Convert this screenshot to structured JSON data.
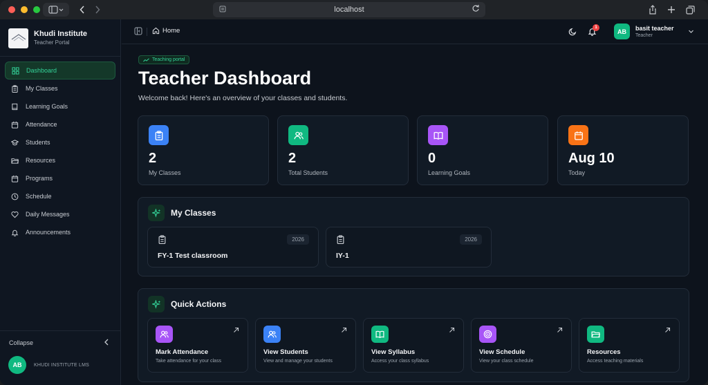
{
  "browser": {
    "url": "localhost",
    "traffic_lights": [
      "#ff5f57",
      "#febc2e",
      "#28c840"
    ]
  },
  "sidebar": {
    "brand_title": "Khudi Institute",
    "brand_subtitle": "Teacher Portal",
    "items": [
      {
        "label": "Dashboard",
        "icon": "dashboard-icon",
        "active": true
      },
      {
        "label": "My Classes",
        "icon": "clipboard-icon"
      },
      {
        "label": "Learning Goals",
        "icon": "book-icon"
      },
      {
        "label": "Attendance",
        "icon": "calendar-icon"
      },
      {
        "label": "Students",
        "icon": "graduation-cap-icon"
      },
      {
        "label": "Resources",
        "icon": "folder-icon"
      },
      {
        "label": "Programs",
        "icon": "calendar-icon"
      },
      {
        "label": "Schedule",
        "icon": "clock-icon"
      },
      {
        "label": "Daily Messages",
        "icon": "heart-icon"
      },
      {
        "label": "Announcements",
        "icon": "bell-icon"
      }
    ],
    "collapse_label": "Collapse",
    "footer_initials": "AB",
    "footer_text": "KHUDI INSTITUTE LMS"
  },
  "topbar": {
    "breadcrumb": "Home",
    "notification_count": "1",
    "user_initials": "AB",
    "user_name": "basit teacher",
    "user_role": "Teacher"
  },
  "header": {
    "chip": "Teaching portal",
    "title": "Teacher Dashboard",
    "subtitle": "Welcome back! Here's an overview of your classes and students."
  },
  "stats": [
    {
      "value": "2",
      "label": "My Classes",
      "color": "#3b82f6",
      "icon": "clipboard-icon"
    },
    {
      "value": "2",
      "label": "Total Students",
      "color": "#10b981",
      "icon": "users-icon"
    },
    {
      "value": "0",
      "label": "Learning Goals",
      "color": "#a855f7",
      "icon": "book-icon"
    },
    {
      "value": "Aug 10",
      "label": "Today",
      "color": "#f97316",
      "icon": "calendar-icon"
    }
  ],
  "my_classes": {
    "title": "My Classes",
    "classes": [
      {
        "name": "FY-1 Test classroom",
        "year": "2026"
      },
      {
        "name": "IY-1",
        "year": "2026"
      }
    ]
  },
  "quick_actions": {
    "title": "Quick Actions",
    "actions": [
      {
        "title": "Mark Attendance",
        "desc": "Take attendance for your class",
        "color": "#a855f7",
        "icon": "users-icon"
      },
      {
        "title": "View Students",
        "desc": "View and manage your students",
        "color": "#3b82f6",
        "icon": "users-icon"
      },
      {
        "title": "View Syllabus",
        "desc": "Access your class syllabus",
        "color": "#10b981",
        "icon": "book-icon"
      },
      {
        "title": "View Schedule",
        "desc": "View your class schedule",
        "color": "#a855f7",
        "icon": "target-icon"
      },
      {
        "title": "Resources",
        "desc": "Access teaching materials",
        "color": "#10b981",
        "icon": "folder-icon"
      }
    ]
  }
}
